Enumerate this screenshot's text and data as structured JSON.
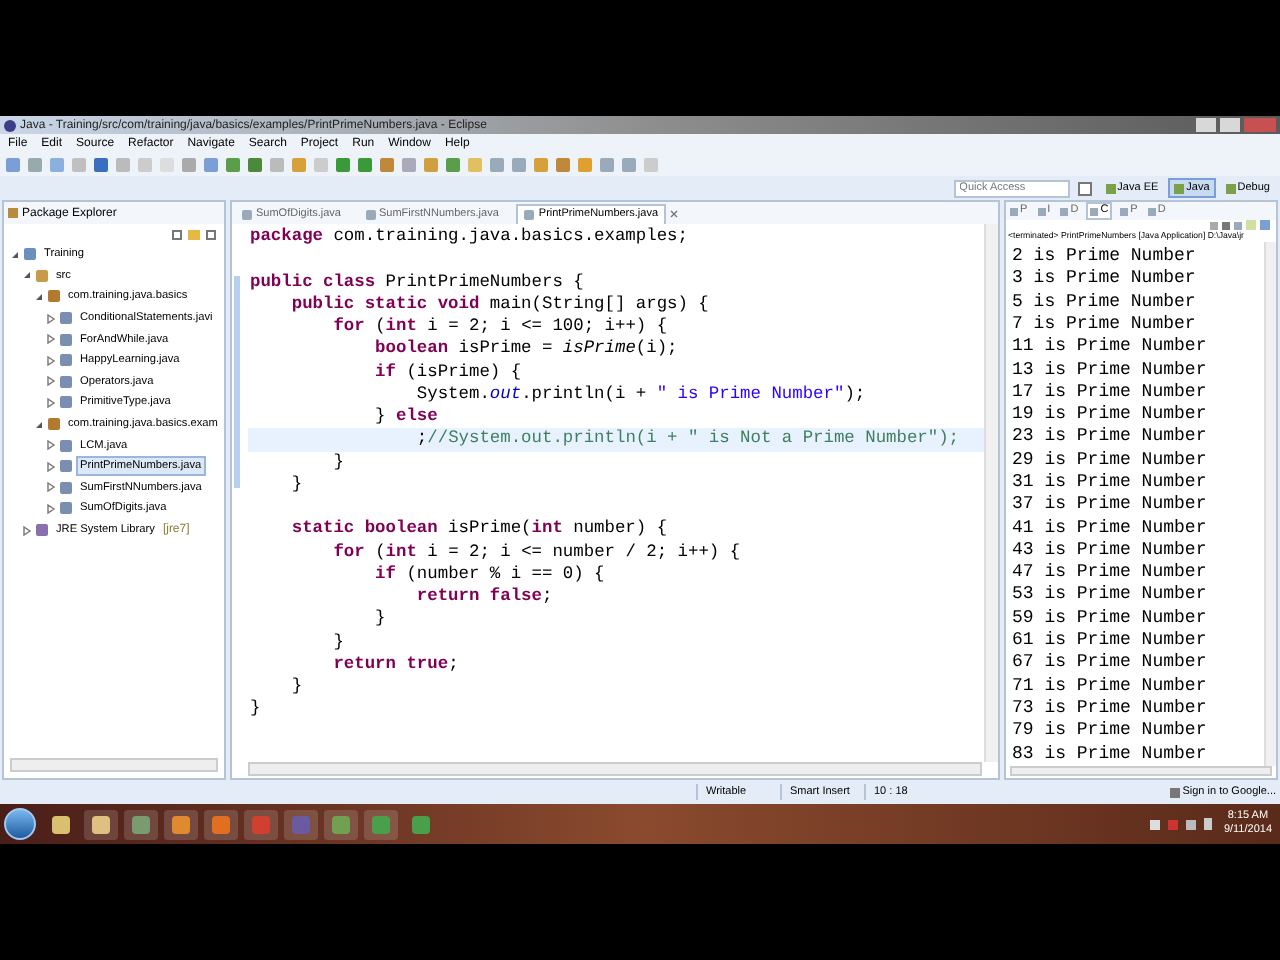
{
  "window": {
    "title": "Java - Training/src/com/training/java/basics/examples/PrintPrimeNumbers.java - Eclipse"
  },
  "menu": [
    "File",
    "Edit",
    "Source",
    "Refactor",
    "Navigate",
    "Search",
    "Project",
    "Run",
    "Window",
    "Help"
  ],
  "quick_access": {
    "placeholder": "Quick Access"
  },
  "perspectives": [
    {
      "label": "Java EE",
      "selected": false
    },
    {
      "label": "Java",
      "selected": true
    },
    {
      "label": "Debug",
      "selected": false
    }
  ],
  "package_explorer": {
    "title": "Package Explorer",
    "tree": [
      {
        "label": "Training",
        "kind": "project",
        "expanded": true,
        "selected": false,
        "children": [
          {
            "label": "src",
            "kind": "folder",
            "expanded": true,
            "selected": false,
            "children": [
              {
                "label": "com.training.java.basics",
                "kind": "package",
                "expanded": true,
                "selected": false,
                "children": [
                  {
                    "label": "ConditionalStatements.javi",
                    "kind": "file",
                    "expanded": false,
                    "selected": false
                  },
                  {
                    "label": "ForAndWhile.java",
                    "kind": "file",
                    "expanded": false,
                    "selected": false
                  },
                  {
                    "label": "HappyLearning.java",
                    "kind": "file",
                    "expanded": false,
                    "selected": false
                  },
                  {
                    "label": "Operators.java",
                    "kind": "file",
                    "expanded": false,
                    "selected": false
                  },
                  {
                    "label": "PrimitiveType.java",
                    "kind": "file",
                    "expanded": false,
                    "selected": false
                  }
                ]
              },
              {
                "label": "com.training.java.basics.exam",
                "kind": "package",
                "expanded": true,
                "selected": false,
                "children": [
                  {
                    "label": "LCM.java",
                    "kind": "file",
                    "expanded": false,
                    "selected": false
                  },
                  {
                    "label": "PrintPrimeNumbers.java",
                    "kind": "file",
                    "expanded": false,
                    "selected": true
                  },
                  {
                    "label": "SumFirstNNumbers.java",
                    "kind": "file",
                    "expanded": false,
                    "selected": false
                  },
                  {
                    "label": "SumOfDigits.java",
                    "kind": "file",
                    "expanded": false,
                    "selected": false
                  }
                ]
              }
            ]
          },
          {
            "label": "JRE System Library",
            "suffix": "[jre7]",
            "kind": "library",
            "expanded": false,
            "selected": false
          }
        ]
      }
    ]
  },
  "editor": {
    "tabs": [
      {
        "label": "SumOfDigits.java",
        "selected": false
      },
      {
        "label": "SumFirstNNumbers.java",
        "selected": false
      },
      {
        "label": "PrintPrimeNumbers.java",
        "selected": true
      }
    ],
    "lines": [
      {
        "kind": "code",
        "current": false,
        "tokens": [
          {
            "kind": "kw",
            "text": "package"
          },
          {
            "kind": "plain",
            "text": " com.training.java.basics.examples;"
          }
        ]
      },
      {
        "kind": "blank"
      },
      {
        "kind": "code",
        "current": false,
        "tokens": [
          {
            "kind": "kw",
            "text": "public class"
          },
          {
            "kind": "plain",
            "text": " PrintPrimeNumbers {"
          }
        ]
      },
      {
        "kind": "code",
        "current": false,
        "tokens": [
          {
            "kind": "kw",
            "text": "    public static void"
          },
          {
            "kind": "plain",
            "text": " main(String[] args) {"
          }
        ]
      },
      {
        "kind": "code",
        "current": false,
        "tokens": [
          {
            "kind": "kw",
            "text": "        for"
          },
          {
            "kind": "plain",
            "text": " ("
          },
          {
            "kind": "kw",
            "text": "int"
          },
          {
            "kind": "plain",
            "text": " i = 2; i <= 100; i++) {"
          }
        ]
      },
      {
        "kind": "code",
        "current": false,
        "tokens": [
          {
            "kind": "kw",
            "text": "            boolean"
          },
          {
            "kind": "plain",
            "text": " isPrime = "
          },
          {
            "kind": "static",
            "text": "isPrime"
          },
          {
            "kind": "plain",
            "text": "(i);"
          }
        ]
      },
      {
        "kind": "code",
        "current": false,
        "tokens": [
          {
            "kind": "kw",
            "text": "            if"
          },
          {
            "kind": "plain",
            "text": " (isPrime) {"
          }
        ]
      },
      {
        "kind": "code",
        "current": false,
        "tokens": [
          {
            "kind": "plain",
            "text": "                System."
          },
          {
            "kind": "field",
            "text": "out"
          },
          {
            "kind": "plain",
            "text": ".println(i + "
          },
          {
            "kind": "str",
            "text": "\" is Prime Number\""
          },
          {
            "kind": "plain",
            "text": ");"
          }
        ]
      },
      {
        "kind": "code",
        "current": false,
        "tokens": [
          {
            "kind": "plain",
            "text": "            } "
          },
          {
            "kind": "kw",
            "text": "else"
          }
        ]
      },
      {
        "kind": "code",
        "current": true,
        "tokens": [
          {
            "kind": "plain",
            "text": "                ;"
          },
          {
            "kind": "cmt",
            "text": "//System.out.println(i + \" is Not a Prime Number\");"
          }
        ]
      },
      {
        "kind": "code",
        "current": false,
        "tokens": [
          {
            "kind": "plain",
            "text": "        }"
          }
        ]
      },
      {
        "kind": "code",
        "current": false,
        "tokens": [
          {
            "kind": "plain",
            "text": "    }"
          }
        ]
      },
      {
        "kind": "blank"
      },
      {
        "kind": "code",
        "current": false,
        "tokens": [
          {
            "kind": "kw",
            "text": "    static boolean"
          },
          {
            "kind": "plain",
            "text": " isPrime("
          },
          {
            "kind": "kw",
            "text": "int"
          },
          {
            "kind": "plain",
            "text": " number) {"
          }
        ]
      },
      {
        "kind": "code",
        "current": false,
        "tokens": [
          {
            "kind": "kw",
            "text": "        for"
          },
          {
            "kind": "plain",
            "text": " ("
          },
          {
            "kind": "kw",
            "text": "int"
          },
          {
            "kind": "plain",
            "text": " i = 2; i <= number / 2; i++) {"
          }
        ]
      },
      {
        "kind": "code",
        "current": false,
        "tokens": [
          {
            "kind": "kw",
            "text": "            if"
          },
          {
            "kind": "plain",
            "text": " (number % i == 0) {"
          }
        ]
      },
      {
        "kind": "code",
        "current": false,
        "tokens": [
          {
            "kind": "kw",
            "text": "                return false"
          },
          {
            "kind": "plain",
            "text": ";"
          }
        ]
      },
      {
        "kind": "code",
        "current": false,
        "tokens": [
          {
            "kind": "plain",
            "text": "            }"
          }
        ]
      },
      {
        "kind": "code",
        "current": false,
        "tokens": [
          {
            "kind": "plain",
            "text": "        }"
          }
        ]
      },
      {
        "kind": "code",
        "current": false,
        "tokens": [
          {
            "kind": "kw",
            "text": "        return true"
          },
          {
            "kind": "plain",
            "text": ";"
          }
        ]
      },
      {
        "kind": "code",
        "current": false,
        "tokens": [
          {
            "kind": "plain",
            "text": "    }"
          }
        ]
      },
      {
        "kind": "code",
        "current": false,
        "tokens": [
          {
            "kind": "plain",
            "text": "}"
          }
        ]
      }
    ]
  },
  "console": {
    "tabs": [
      {
        "label": "P",
        "selected": false
      },
      {
        "label": "I",
        "selected": false
      },
      {
        "label": "D",
        "selected": false
      },
      {
        "label": "C",
        "selected": true
      },
      {
        "label": "P",
        "selected": false
      },
      {
        "label": "D",
        "selected": false
      }
    ],
    "header": "<terminated> PrintPrimeNumbers [Java Application] D:\\Java\\jr",
    "lines": [
      "2 is Prime Number",
      "3 is Prime Number",
      "5 is Prime Number",
      "7 is Prime Number",
      "11 is Prime Number",
      "13 is Prime Number",
      "17 is Prime Number",
      "19 is Prime Number",
      "23 is Prime Number",
      "29 is Prime Number",
      "31 is Prime Number",
      "37 is Prime Number",
      "41 is Prime Number",
      "43 is Prime Number",
      "47 is Prime Number",
      "53 is Prime Number",
      "59 is Prime Number",
      "61 is Prime Number",
      "67 is Prime Number",
      "71 is Prime Number",
      "73 is Prime Number",
      "79 is Prime Number",
      "83 is Prime Number"
    ]
  },
  "status_bar": {
    "fields": [
      "Writable",
      "Smart Insert",
      "10 : 18"
    ],
    "sign_in": "Sign in to Google..."
  },
  "taskbar": {
    "time": "8:15 AM",
    "date": "9/11/2014"
  }
}
